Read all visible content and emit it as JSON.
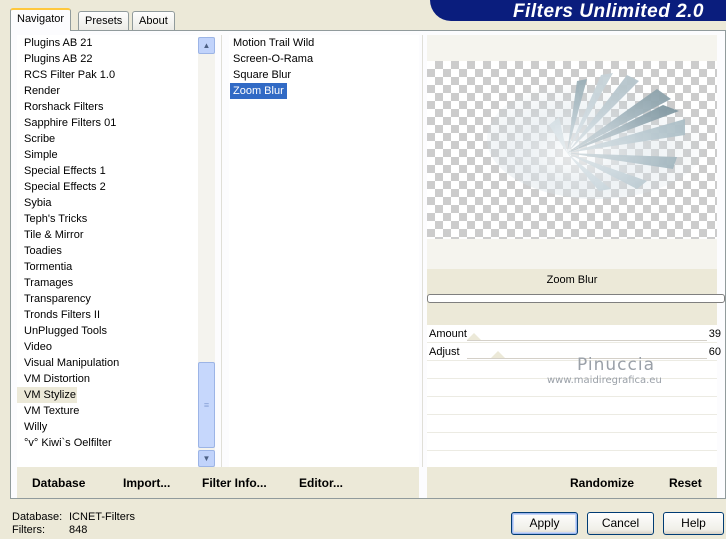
{
  "app": {
    "title": "Filters Unlimited 2.0"
  },
  "tabs": [
    {
      "label": "Navigator"
    },
    {
      "label": "Presets"
    },
    {
      "label": "About"
    }
  ],
  "categories": [
    "Plugins AB 21",
    "Plugins AB 22",
    "RCS Filter Pak 1.0",
    "Render",
    "Rorshack Filters",
    "Sapphire Filters 01",
    "Scribe",
    "Simple",
    "Special Effects 1",
    "Special Effects 2",
    "Sybia",
    "Teph's Tricks",
    "Tile & Mirror",
    "Toadies",
    "Tormentia",
    "Tramages",
    "Transparency",
    "Tronds Filters II",
    "UnPlugged Tools",
    "Video",
    "Visual Manipulation",
    "VM Distortion",
    "VM Stylize",
    "VM Texture",
    "Willy",
    "°v° Kiwi`s Oelfilter"
  ],
  "selected_category": "VM Stylize",
  "filters": [
    "Motion Trail Wild",
    "Screen-O-Rama",
    "Square Blur",
    "Zoom Blur"
  ],
  "selected_filter": "Zoom Blur",
  "preview": {
    "filter_name": "Zoom Blur"
  },
  "params": [
    {
      "label": "Amount",
      "value": "39"
    },
    {
      "label": "Adjust",
      "value": "60"
    }
  ],
  "watermark": {
    "line1": "Pinuccia",
    "line2": "www.maidiregrafica.eu"
  },
  "left_buttons": {
    "database": "Database",
    "import": "Import...",
    "filter_info": "Filter Info...",
    "editor": "Editor..."
  },
  "right_buttons": {
    "randomize": "Randomize",
    "reset": "Reset"
  },
  "status": {
    "database_label": "Database:",
    "database_value": "ICNET-Filters",
    "filters_label": "Filters:",
    "filters_value": "848"
  },
  "dialog_buttons": {
    "apply": "Apply",
    "cancel": "Cancel",
    "help": "Help"
  },
  "colors": {
    "banner": "#0a1d7d",
    "selection": "#316ac5",
    "face": "#ece9d8"
  }
}
